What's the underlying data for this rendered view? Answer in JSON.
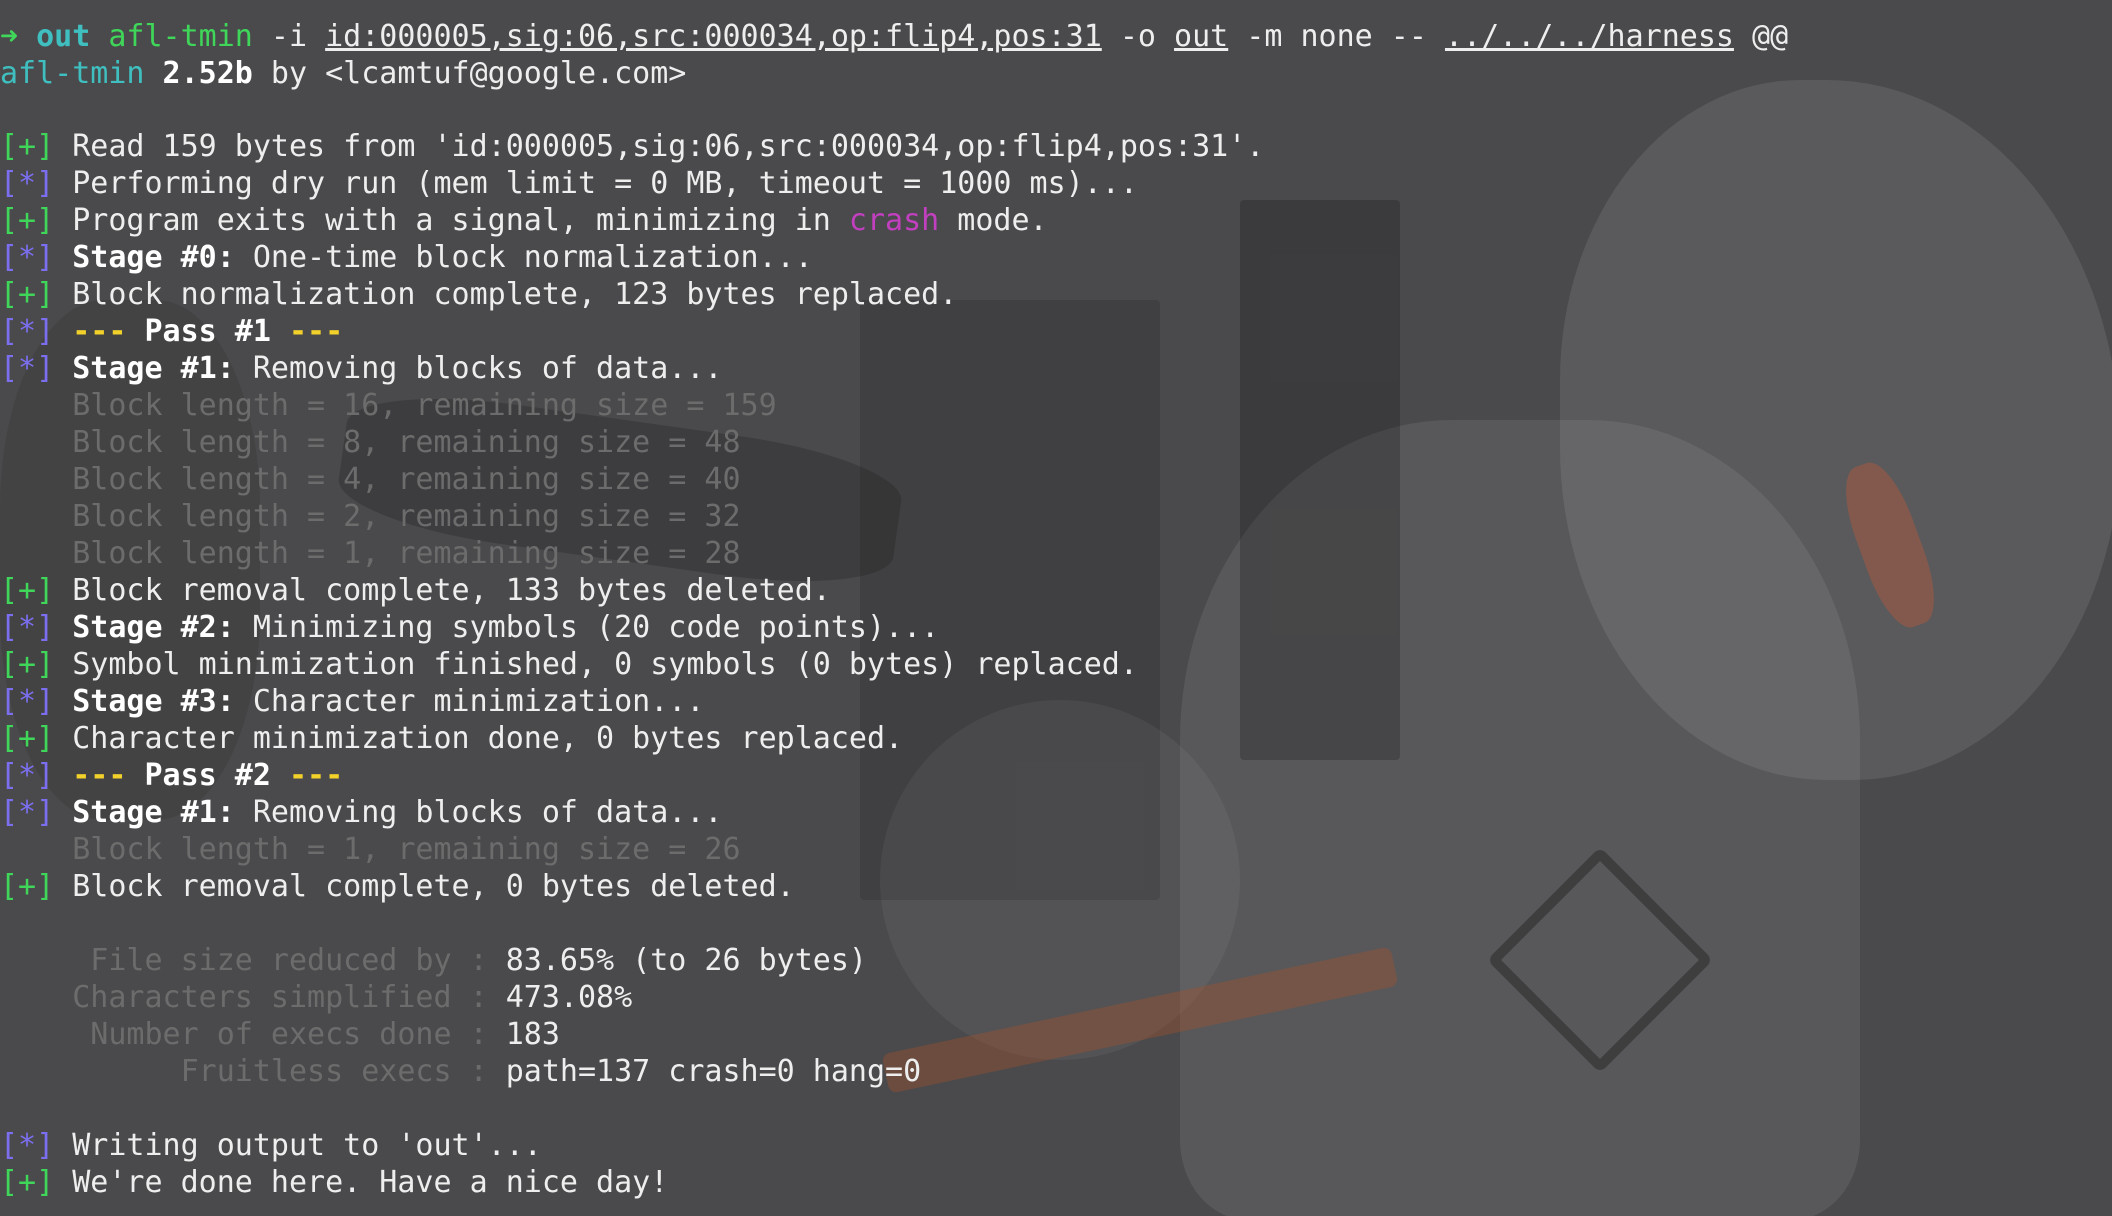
{
  "prompt": {
    "arrow": "➜",
    "dir": "out",
    "cmd": "afl-tmin",
    "flag_i": " -i ",
    "input_file": "id:000005,sig:06,src:000034,op:flip4,pos:31",
    "flag_o": " -o ",
    "output_file": "out",
    "flag_m": " -m none -- ",
    "harness": "../../../harness",
    "at": " @@"
  },
  "banner": {
    "name": "afl-tmin",
    "version": " 2.52b",
    "by": " by <lcamtuf@google.com>"
  },
  "tags": {
    "plus": "[+]",
    "star": "[*]"
  },
  "log": {
    "read": " Read 159 bytes from 'id:000005,sig:06,src:000034,op:flip4,pos:31'.",
    "dry_run": " Performing dry run (mem limit = 0 MB, timeout = 1000 ms)...",
    "signal_pre": " Program exits with a signal, minimizing in ",
    "signal_mode": "crash",
    "signal_post": " mode.",
    "stage0_label": " Stage #0:",
    "stage0_text": " One-time block normalization...",
    "norm_done": " Block normalization complete, 123 bytes replaced.",
    "pass1_pre": " ---",
    "pass1_label": " Pass #1",
    "pass1_post": " ---",
    "stage1_label": " Stage #1:",
    "stage1_text": " Removing blocks of data...",
    "block_lines_pass1": [
      "    Block length = 16, remaining size = 159",
      "    Block length = 8, remaining size = 48",
      "    Block length = 4, remaining size = 40",
      "    Block length = 2, remaining size = 32",
      "    Block length = 1, remaining size = 28"
    ],
    "removal_done_1": " Block removal complete, 133 bytes deleted.",
    "stage2_label": " Stage #2:",
    "stage2_text": " Minimizing symbols (20 code points)...",
    "symbol_done": " Symbol minimization finished, 0 symbols (0 bytes) replaced.",
    "stage3_label": " Stage #3:",
    "stage3_text": " Character minimization...",
    "char_done": " Character minimization done, 0 bytes replaced.",
    "pass2_pre": " ---",
    "pass2_label": " Pass #2",
    "pass2_post": " ---",
    "stage1b_label": " Stage #1:",
    "stage1b_text": " Removing blocks of data...",
    "block_line_pass2": "    Block length = 1, remaining size = 26",
    "removal_done_2": " Block removal complete, 0 bytes deleted.",
    "writing": " Writing output to 'out'...",
    "done": " We're done here. Have a nice day!"
  },
  "stats": [
    {
      "label": "     File size reduced by : ",
      "value": "83.65% (to 26 bytes)"
    },
    {
      "label": "    Characters simplified : ",
      "value": "473.08%"
    },
    {
      "label": "     Number of execs done : ",
      "value": "183"
    },
    {
      "label": "          Fruitless execs : ",
      "value": "path=137 crash=0 hang=0"
    }
  ],
  "colors": {
    "background": "#4a4a4c",
    "green": "#3fd65a",
    "cyan": "#3fbfbf",
    "blue": "#7b6ff0",
    "yellow": "#f2d22a",
    "magenta": "#c23fbf",
    "dim": "#6c6c6c"
  }
}
